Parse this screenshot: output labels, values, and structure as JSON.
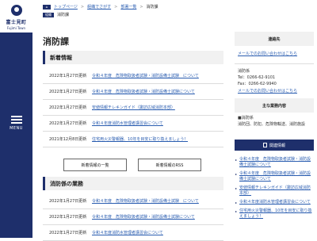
{
  "logo": {
    "name": "富士見町",
    "sub": "Fujimi Town"
  },
  "menu": {
    "label": "MENU"
  },
  "breadcrumb": [
    "トップページ",
    "組織でさがす",
    "部署一覧",
    "消防課"
  ],
  "subbar": {
    "tag": "組織",
    "label": "消防課"
  },
  "page_title": "消防課",
  "news_heading": "新着情報",
  "news": [
    {
      "date": "2022年1月27日更新",
      "title": "令和４年度　危険物取扱者試験・消防設備士試験　について"
    },
    {
      "date": "2022年1月27日更新",
      "title": "令和４年度　危険物取扱者試験・消防設備士試験について"
    },
    {
      "date": "2022年1月27日更新",
      "title": "安値情報チレキンガイド（諏訪広域消防本部）"
    },
    {
      "date": "2022年1月27日更新",
      "title": "令和４年度消防水管理者講習会について"
    },
    {
      "date": "2021年12月8日更新",
      "title": "住宅用火災警報器、10年を目安に取り換えましょう！"
    }
  ],
  "buttons": {
    "list": "新着情報の一覧",
    "rss": "新着情報のRSS"
  },
  "section2_heading": "消防係の業務",
  "section2": [
    {
      "date": "2022年1月27日更新",
      "title": "令和４年度　危険物取扱者試験・消防設備士試験　について"
    },
    {
      "date": "2022年1月27日更新",
      "title": "令和４年度　危険物取扱者試験・消防設備士試験について"
    },
    {
      "date": "2022年1月27日更新",
      "title": "令和４年度消防水管理者講習会について"
    }
  ],
  "contact": {
    "heading": "連絡先",
    "mail_link": "メールでのお問い合わせはこちら",
    "dept": "消防係",
    "tel": "Tel：0266-62-9101",
    "fax": "Fax：0266-62-9940",
    "mail_link2": "メールでのお問い合わせはこちら"
  },
  "duties": {
    "heading": "主な業務内容",
    "dept": "■消防係",
    "text": "消防団、防犯、危険物輸送、消防施設"
  },
  "related": {
    "label": "関連情報"
  },
  "related_links": [
    "令和４年度　危険物取扱者試験・消防設備士試験について",
    "令和４年度　危険物取扱者試験・消防設備士試験について",
    "安値情報チレキンガイド（諏訪広域消防本部）",
    "令和４年度消防水管理者講習会について",
    "住宅用火災警報器、10年を目安に取り換えましょう！"
  ],
  "colors": {
    "navy": "#1e2f6b",
    "link": "#2a5db0"
  }
}
